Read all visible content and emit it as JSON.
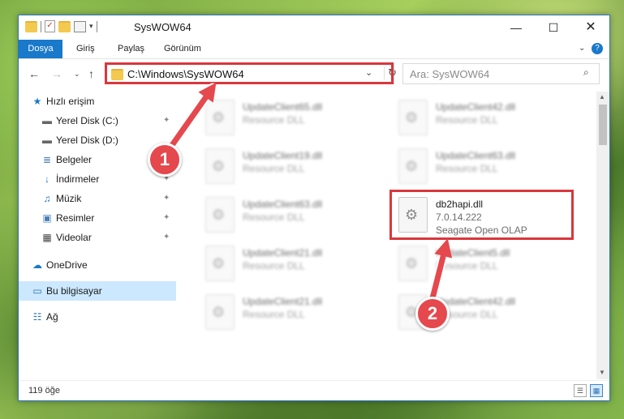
{
  "window": {
    "title": "SysWOW64",
    "minimize": "—",
    "maximize": "☐",
    "close": "✕"
  },
  "ribbon": {
    "tabs": [
      "Dosya",
      "Giriş",
      "Paylaş",
      "Görünüm"
    ],
    "collapse": "⌄",
    "help": "?"
  },
  "nav": {
    "back": "←",
    "forward": "→",
    "recent": "⌄",
    "up": "↑"
  },
  "address": {
    "path": "C:\\Windows\\SysWOW64",
    "dropdown": "⌄",
    "refresh": "↻"
  },
  "search": {
    "placeholder": "Ara: SysWOW64",
    "icon": "⌕"
  },
  "sidebar": {
    "items": [
      {
        "label": "Hızlı erişim",
        "icon": "star-icon",
        "glyph": "★",
        "pinned": false
      },
      {
        "label": "Yerel Disk (C:)",
        "icon": "disk-icon",
        "glyph": "▬",
        "pinned": true
      },
      {
        "label": "Yerel Disk (D:)",
        "icon": "disk-icon",
        "glyph": "▬",
        "pinned": false
      },
      {
        "label": "Belgeler",
        "icon": "documents-icon",
        "glyph": "≣",
        "pinned": true
      },
      {
        "label": "İndirmeler",
        "icon": "download-icon",
        "glyph": "↓",
        "pinned": true
      },
      {
        "label": "Müzik",
        "icon": "music-icon",
        "glyph": "♫",
        "pinned": true
      },
      {
        "label": "Resimler",
        "icon": "pictures-icon",
        "glyph": "▣",
        "pinned": true
      },
      {
        "label": "Videolar",
        "icon": "video-icon",
        "glyph": "▦",
        "pinned": true
      },
      {
        "label": "OneDrive",
        "icon": "cloud-icon",
        "glyph": "☁",
        "pinned": false
      },
      {
        "label": "Bu bilgisayar",
        "icon": "computer-icon",
        "glyph": "▭",
        "pinned": false
      },
      {
        "label": "Ağ",
        "icon": "network-icon",
        "glyph": "☷",
        "pinned": false
      }
    ],
    "pin_glyph": "📌"
  },
  "files": [
    {
      "name": "UpdateClient65.dll",
      "line2": "Resource DLL",
      "line3": "",
      "blurred": true
    },
    {
      "name": "UpdateClient42.dll",
      "line2": "Resource DLL",
      "line3": "",
      "blurred": true
    },
    {
      "name": "UpdateClient19.dll",
      "line2": "Resource DLL",
      "line3": "",
      "blurred": true
    },
    {
      "name": "UpdateClient63.dll",
      "line2": "Resource DLL",
      "line3": "",
      "blurred": true
    },
    {
      "name": "UpdateClient63.dll",
      "line2": "Resource DLL",
      "line3": "",
      "blurred": true
    },
    {
      "name": "db2hapi.dll",
      "line2": "7.0.14.222",
      "line3": "Seagate Open OLAP",
      "blurred": false
    },
    {
      "name": "UpdateClient21.dll",
      "line2": "Resource DLL",
      "line3": "",
      "blurred": true
    },
    {
      "name": "UpdateClient5.dll",
      "line2": "Resource DLL",
      "line3": "",
      "blurred": true
    },
    {
      "name": "UpdateClient21.dll",
      "line2": "Resource DLL",
      "line3": "",
      "blurred": true
    },
    {
      "name": "UpdateClient42.dll",
      "line2": "Resource DLL",
      "line3": "",
      "blurred": true
    }
  ],
  "status": {
    "count": "119 öğe"
  },
  "annotations": {
    "step1": "1",
    "step2": "2",
    "highlight_color": "#d9373d"
  }
}
